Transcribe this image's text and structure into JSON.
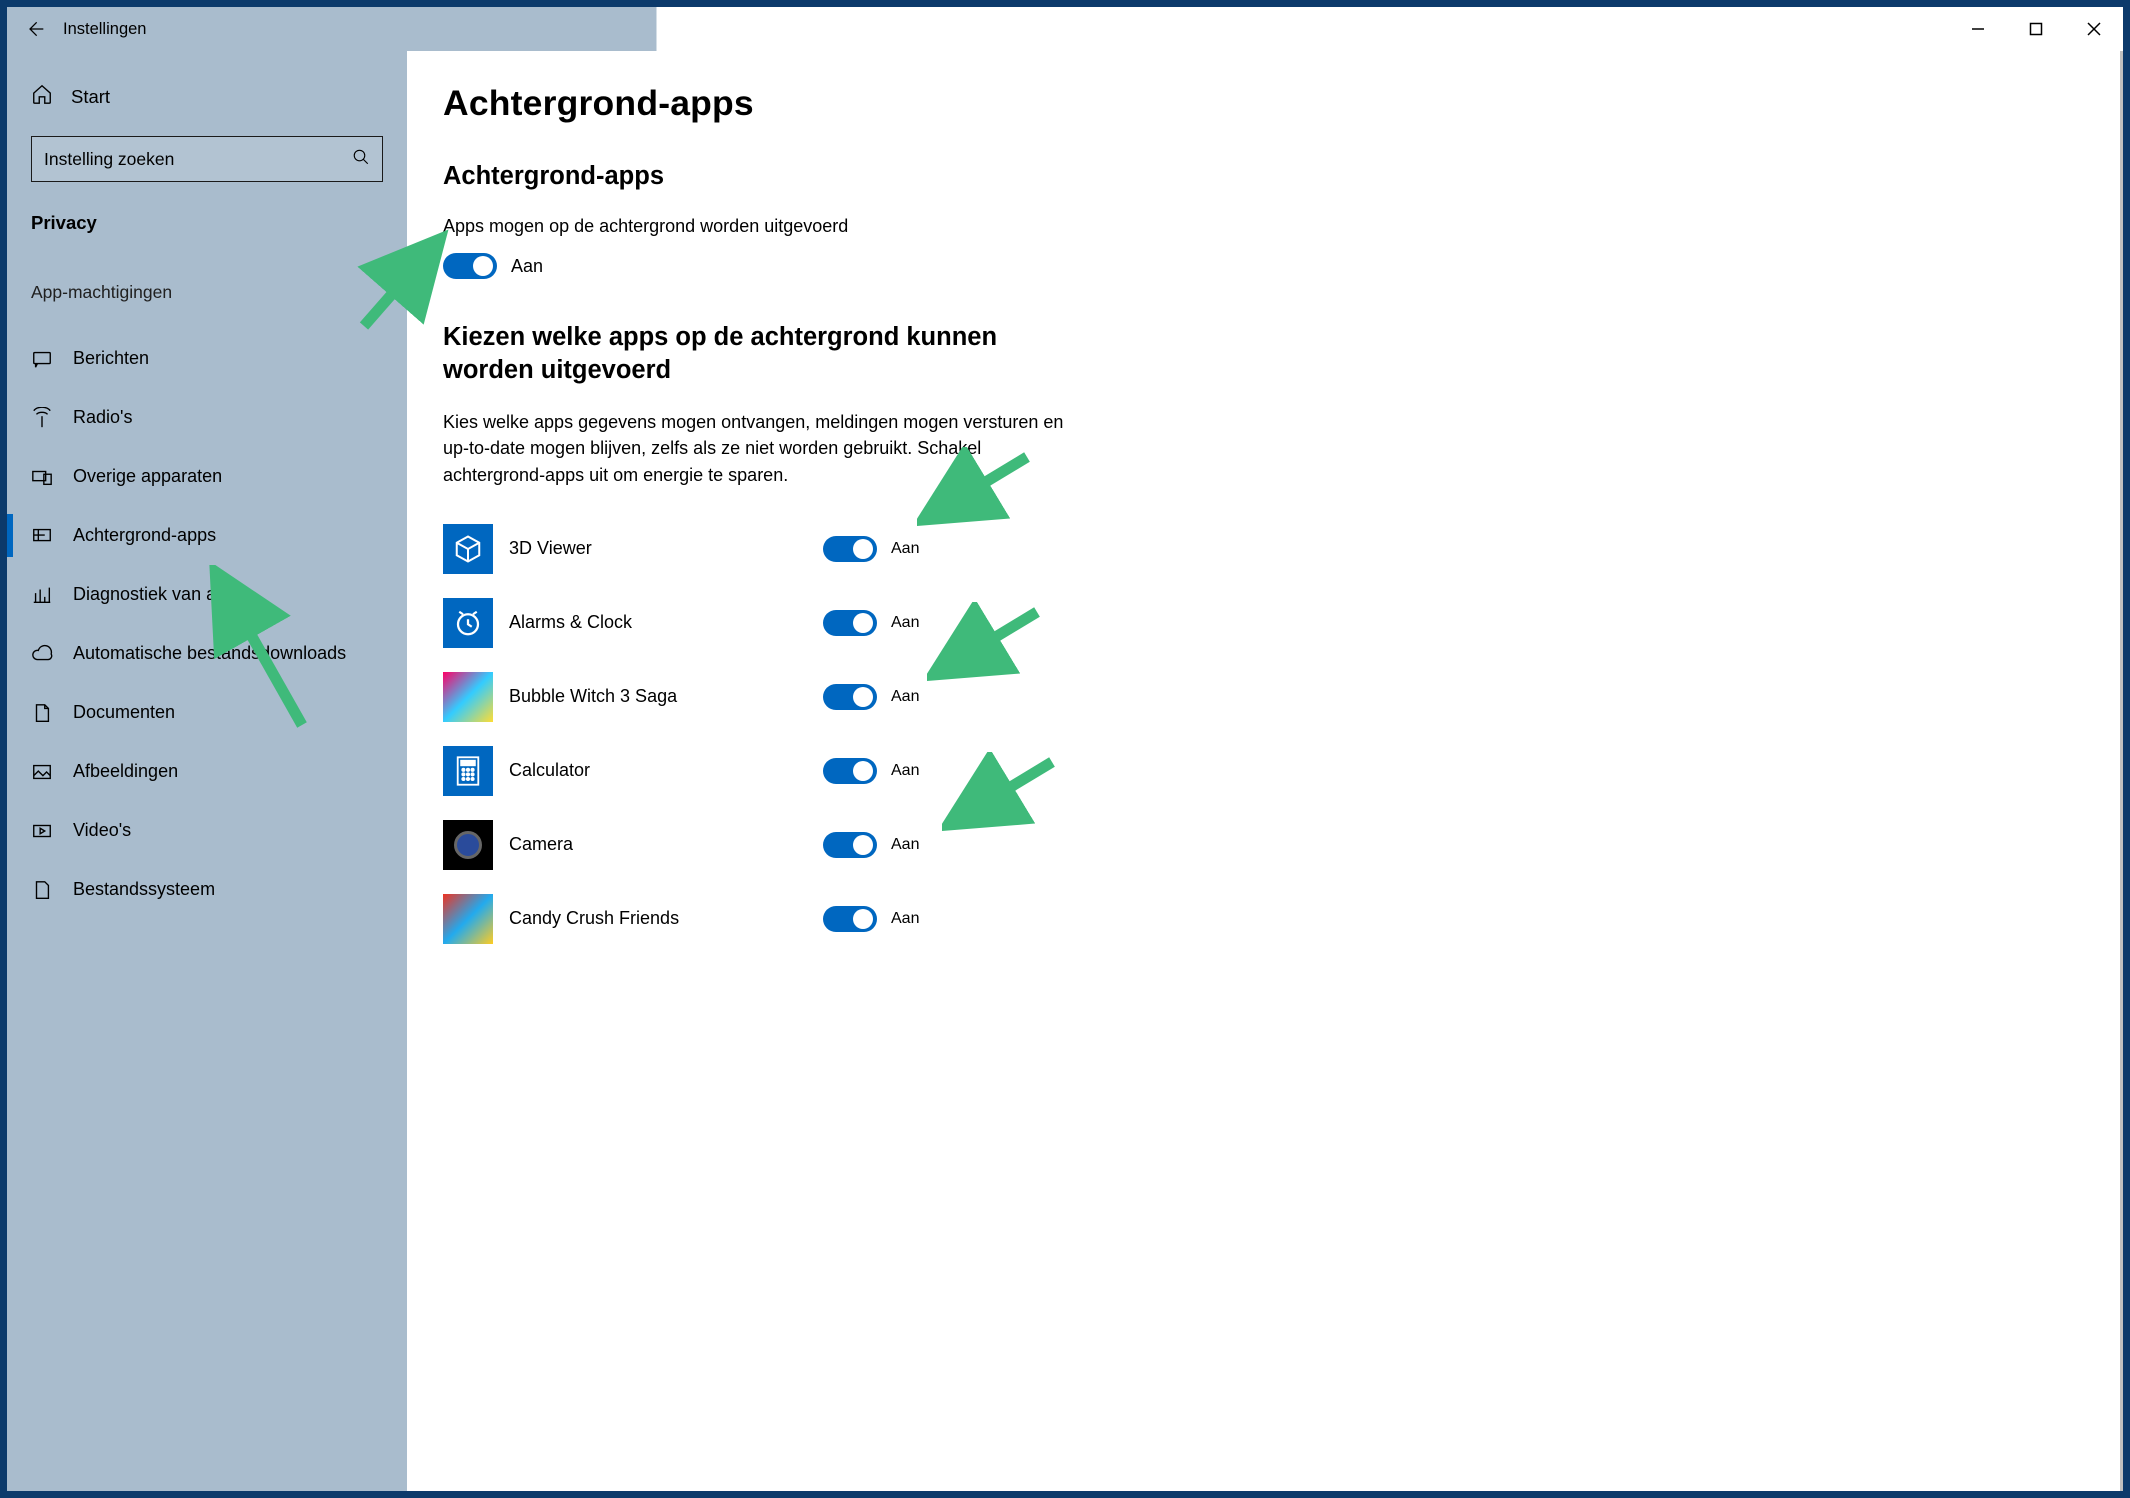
{
  "titlebar": {
    "title": "Instellingen"
  },
  "sidebar": {
    "home": "Start",
    "search_placeholder": "Instelling zoeken",
    "category": "Privacy",
    "section_label": "App-machtigingen",
    "items": [
      {
        "icon": "message-icon",
        "label": "Berichten"
      },
      {
        "icon": "radio-icon",
        "label": "Radio's"
      },
      {
        "icon": "devices-icon",
        "label": "Overige apparaten"
      },
      {
        "icon": "bgapps-icon",
        "label": "Achtergrond-apps",
        "selected": true
      },
      {
        "icon": "chart-icon",
        "label": "Diagnostiek van apps"
      },
      {
        "icon": "cloud-icon",
        "label": "Automatische bestandsdownloads"
      },
      {
        "icon": "document-icon",
        "label": "Documenten"
      },
      {
        "icon": "picture-icon",
        "label": "Afbeeldingen"
      },
      {
        "icon": "video-icon",
        "label": "Video's"
      },
      {
        "icon": "folder-icon",
        "label": "Bestandssysteem"
      }
    ]
  },
  "content": {
    "page_title": "Achtergrond-apps",
    "sub_title": "Achtergrond-apps",
    "allow_desc": "Apps mogen op de achtergrond worden uitgevoerd",
    "master_toggle_label": "Aan",
    "choose_title": "Kiezen welke apps op de achtergrond kunnen worden uitgevoerd",
    "choose_desc": "Kies welke apps gegevens mogen ontvangen, meldingen mogen versturen en up-to-date mogen blijven, zelfs als ze niet worden gebruikt. Schakel achtergrond-apps uit om energie te sparen.",
    "on_label": "Aan",
    "apps": [
      {
        "name": "3D Viewer",
        "icon": "cube"
      },
      {
        "name": "Alarms & Clock",
        "icon": "clock"
      },
      {
        "name": "Bubble Witch 3 Saga",
        "icon": "bw"
      },
      {
        "name": "Calculator",
        "icon": "calc"
      },
      {
        "name": "Camera",
        "icon": "cam"
      },
      {
        "name": "Candy Crush Friends",
        "icon": "ccf"
      }
    ]
  },
  "annotation_arrow_color": "#3fba7a"
}
